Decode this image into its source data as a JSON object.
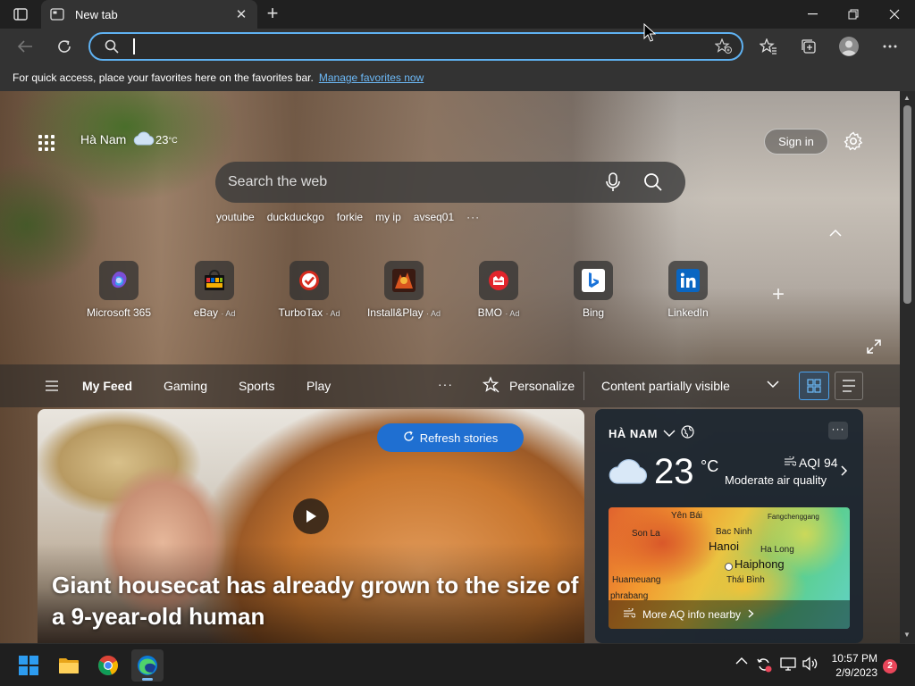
{
  "browser": {
    "tab": {
      "title": "New tab",
      "close": "✕"
    },
    "new_tab": "+",
    "window": {
      "minimize": "—",
      "maximize": "❐",
      "close": "✕"
    },
    "address": {
      "value": "",
      "placeholder": ""
    },
    "favbar": {
      "text": "For quick access, place your favorites here on the favorites bar.",
      "link": "Manage favorites now"
    }
  },
  "header": {
    "location": "Hà Nam",
    "temp": "23",
    "temp_unit": "°C",
    "signin": "Sign in"
  },
  "search": {
    "placeholder": "Search the web",
    "quick_links": [
      "youtube",
      "duckduckgo",
      "forkie",
      "my ip",
      "avseq01"
    ],
    "more": "···"
  },
  "tiles": [
    {
      "label": "Microsoft 365",
      "ad": ""
    },
    {
      "label": "eBay",
      "ad": "· Ad"
    },
    {
      "label": "TurboTax",
      "ad": "· Ad"
    },
    {
      "label": "Install&Play",
      "ad": "· Ad"
    },
    {
      "label": "BMO",
      "ad": "· Ad"
    },
    {
      "label": "Bing",
      "ad": ""
    },
    {
      "label": "LinkedIn",
      "ad": ""
    }
  ],
  "feed": {
    "tabs": [
      "My Feed",
      "Gaming",
      "Sports",
      "Play"
    ],
    "more": "···",
    "personalize": "Personalize",
    "visibility": "Content partially visible"
  },
  "hero": {
    "refresh": "Refresh stories",
    "headline": "Giant housecat has already grown to the size of a 9-year-old human"
  },
  "weather": {
    "location": "HÀ NAM",
    "more": "···",
    "temp": "23",
    "unit": "°C",
    "aqi": "AQI 94",
    "aqi_desc": "Moderate air quality",
    "map_labels": [
      "Yên Bái",
      "Bac Ninh",
      "Fangchenggang",
      "Son La",
      "Hanoi",
      "Ha Long",
      "Haiphong",
      "Huameuang",
      "Thái Bình",
      "phrabang"
    ],
    "more_aq": "More AQ info nearby"
  },
  "taskbar": {
    "time": "10:57 PM",
    "date": "2/9/2023",
    "notifications": "2"
  },
  "colors": {
    "accent": "#1f6fd1",
    "omnibox_border": "#5fb2f2",
    "link": "#6cb8f6"
  }
}
